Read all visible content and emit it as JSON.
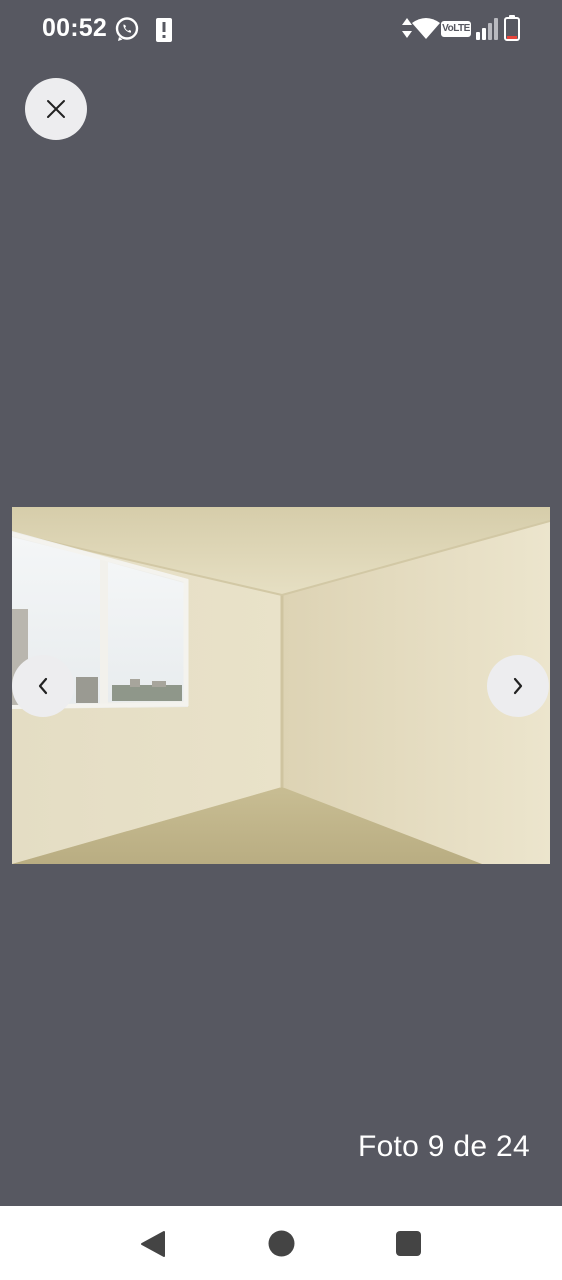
{
  "status_bar": {
    "time": "00:52",
    "icons": [
      "whatsapp-icon",
      "alert-notification-icon",
      "data-arrows-icon",
      "wifi-icon",
      "volte-icon",
      "signal-icon",
      "battery-icon"
    ],
    "volte_label": "VoLTE",
    "battery_level": 0.15
  },
  "viewer": {
    "close_icon": "close-icon",
    "prev_icon": "chevron-left-icon",
    "next_icon": "chevron-right-icon",
    "counter": "Foto 9 de 24"
  },
  "colors": {
    "background": "#575861",
    "button_bg": "#ededef",
    "battery_low": "#e8453c"
  },
  "system_nav": {
    "icons": [
      "back-icon",
      "home-icon",
      "recents-icon"
    ]
  }
}
